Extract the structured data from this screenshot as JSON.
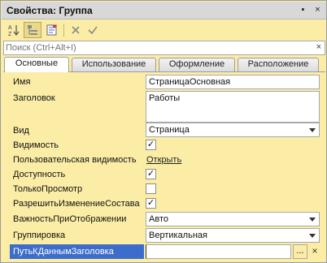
{
  "window": {
    "title": "Свойства: Группа",
    "pin_glyph": "▪",
    "close_glyph": "×"
  },
  "toolbar": {
    "sort_icon": "sort-az-icon",
    "categories_icon": "categories-icon",
    "filter_icon": "filter-icon",
    "clear_icon": "x-icon",
    "apply_icon": "check-icon"
  },
  "search": {
    "placeholder": "Поиск (Ctrl+Alt+I)",
    "clear_glyph": "×"
  },
  "tabs": [
    {
      "label": "Основные",
      "active": true
    },
    {
      "label": "Использование",
      "active": false
    },
    {
      "label": "Оформление",
      "active": false
    },
    {
      "label": "Расположение",
      "active": false
    }
  ],
  "properties": {
    "name": {
      "label": "Имя",
      "value": "СтраницаОсновная"
    },
    "header": {
      "label": "Заголовок",
      "value": "Работы"
    },
    "kind": {
      "label": "Вид",
      "value": "Страница"
    },
    "visibility": {
      "label": "Видимость",
      "checked": true,
      "glyph": "✓"
    },
    "user_visibility": {
      "label": "Пользовательская видимость",
      "link": "Открыть"
    },
    "enabled": {
      "label": "Доступность",
      "checked": true,
      "glyph": "✓"
    },
    "readonly": {
      "label": "ТолькоПросмотр",
      "checked": false,
      "glyph": ""
    },
    "allow_change": {
      "label": "РазрешитьИзменениеСостава",
      "checked": true,
      "glyph": "✓"
    },
    "importance": {
      "label": "ВажностьПриОтображении",
      "value": "Авто"
    },
    "grouping": {
      "label": "Группировка",
      "value": "Вертикальная"
    },
    "header_data_path": {
      "label": "ПутьКДаннымЗаголовка",
      "value": "",
      "dots": "...",
      "clear": "×"
    }
  },
  "colors": {
    "background": "#fbeda6",
    "selection": "#3d6dcc",
    "titlebar": "#d8d8d8"
  }
}
